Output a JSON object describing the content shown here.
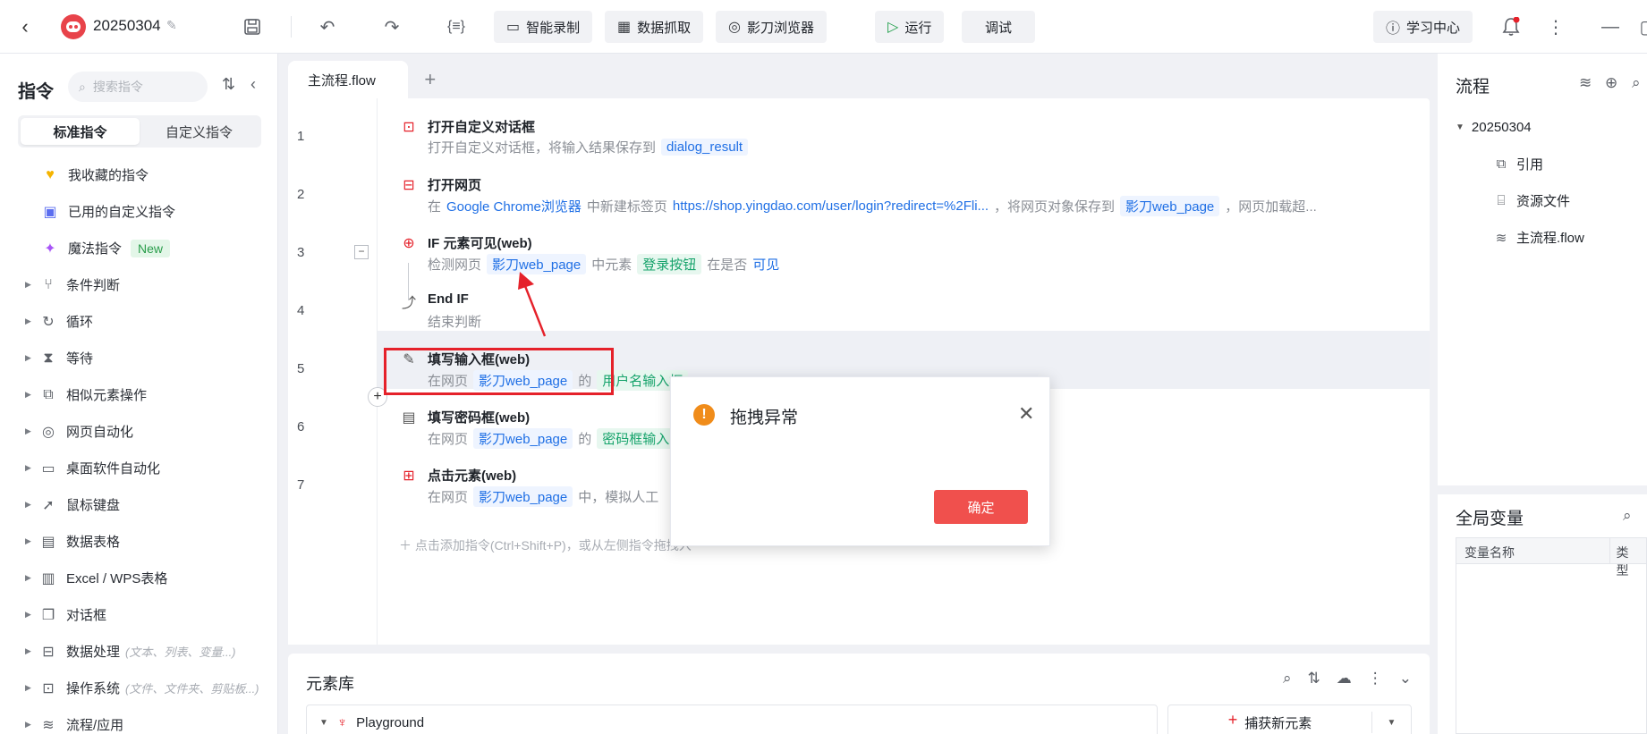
{
  "header": {
    "project_name": "20250304",
    "buttons": {
      "smart_record": "智能录制",
      "data_capture": "数据抓取",
      "browser": "影刀浏览器",
      "run": "运行",
      "debug": "调试",
      "learning": "学习中心"
    }
  },
  "sidebar": {
    "title": "指令",
    "search_placeholder": "搜索指令",
    "tabs": [
      "标准指令",
      "自定义指令"
    ],
    "special_items": [
      {
        "label": "我收藏的指令",
        "icon": "heart-icon"
      },
      {
        "label": "已用的自定义指令",
        "icon": "calendar-icon"
      },
      {
        "label": "魔法指令",
        "icon": "sparkle-icon",
        "badge": "New"
      }
    ],
    "categories": [
      {
        "label": "条件判断",
        "icon": "branch-icon",
        "note": ""
      },
      {
        "label": "循环",
        "icon": "loop-icon",
        "note": ""
      },
      {
        "label": "等待",
        "icon": "hourglass-icon",
        "note": ""
      },
      {
        "label": "相似元素操作",
        "icon": "copy-icon",
        "note": ""
      },
      {
        "label": "网页自动化",
        "icon": "browser-icon",
        "note": ""
      },
      {
        "label": "桌面软件自动化",
        "icon": "monitor-icon",
        "note": ""
      },
      {
        "label": "鼠标键盘",
        "icon": "cursor-icon",
        "note": ""
      },
      {
        "label": "数据表格",
        "icon": "document-icon",
        "note": ""
      },
      {
        "label": "Excel / WPS表格",
        "icon": "excel-icon",
        "note": ""
      },
      {
        "label": "对话框",
        "icon": "dialog-icon",
        "note": ""
      },
      {
        "label": "数据处理",
        "icon": "data-icon",
        "note": "(文本、列表、变量...)"
      },
      {
        "label": "操作系统",
        "icon": "briefcase-icon",
        "note": "(文件、文件夹、剪贴板...)"
      },
      {
        "label": "流程/应用",
        "icon": "layers-icon",
        "note": ""
      }
    ]
  },
  "editor": {
    "tab_name": "主流程.flow",
    "rows": [
      {
        "num": "1",
        "title": "打开自定义对话框",
        "desc": [
          {
            "t": "text",
            "v": "打开自定义对话框，将输入结果保存到"
          },
          {
            "t": "tag",
            "v": "dialog_result"
          }
        ]
      },
      {
        "num": "2",
        "title": "打开网页",
        "desc": [
          {
            "t": "text",
            "v": "在"
          },
          {
            "t": "link",
            "v": "Google Chrome浏览器"
          },
          {
            "t": "text",
            "v": "中新建标签页"
          },
          {
            "t": "link",
            "v": "https://shop.yingdao.com/user/login?redirect=%2Fli..."
          },
          {
            "t": "text",
            "v": "，将网页对象保存到"
          },
          {
            "t": "tag",
            "v": "影刀web_page"
          },
          {
            "t": "text",
            "v": "，网页加载超..."
          }
        ]
      },
      {
        "num": "3",
        "title": "IF 元素可见(web)",
        "desc": [
          {
            "t": "text",
            "v": "检测网页"
          },
          {
            "t": "tag",
            "v": "影刀web_page"
          },
          {
            "t": "text",
            "v": "中元素"
          },
          {
            "t": "tag-g",
            "v": "登录按钮"
          },
          {
            "t": "text",
            "v": "在是否"
          },
          {
            "t": "link",
            "v": "可见"
          }
        ]
      },
      {
        "num": "4",
        "title": "End IF",
        "desc": [
          {
            "t": "text",
            "v": "结束判断"
          }
        ]
      },
      {
        "num": "5",
        "title": "填写输入框(web)",
        "desc": [
          {
            "t": "text",
            "v": "在网页"
          },
          {
            "t": "tag",
            "v": "影刀web_page"
          },
          {
            "t": "text",
            "v": "的"
          },
          {
            "t": "tag-g",
            "v": "用户名输入框"
          }
        ]
      },
      {
        "num": "6",
        "title": "填写密码框(web)",
        "desc": [
          {
            "t": "text",
            "v": "在网页"
          },
          {
            "t": "tag",
            "v": "影刀web_page"
          },
          {
            "t": "text",
            "v": "的"
          },
          {
            "t": "tag-g",
            "v": "密码框输入"
          }
        ]
      },
      {
        "num": "7",
        "title": "点击元素(web)",
        "desc": [
          {
            "t": "text",
            "v": "在网页"
          },
          {
            "t": "tag",
            "v": "影刀web_page"
          },
          {
            "t": "text",
            "v": "中，模拟人工"
          }
        ]
      }
    ],
    "add_hint": "点击添加指令(Ctrl+Shift+P)，或从左侧指令拖拽入"
  },
  "element_library": {
    "title": "元素库",
    "tree_root": "Playground",
    "capture_label": "捕获新元素"
  },
  "right_panel": {
    "title": "流程",
    "root": "20250304",
    "nodes": [
      {
        "label": "引用",
        "icon": "reference-icon"
      },
      {
        "label": "资源文件",
        "icon": "file-icon"
      },
      {
        "label": "主流程.flow",
        "icon": "layers-icon"
      }
    ],
    "globals_title": "全局变量",
    "columns": [
      "变量名称",
      "类型"
    ]
  },
  "dialog": {
    "title": "拖拽异常",
    "ok_label": "确定"
  },
  "colors": {
    "accent_red": "#f0504d",
    "highlight_box": "#e5212a",
    "tag_blue": "#1f6fe5",
    "tag_green": "#16a36b",
    "warning_orange": "#f08c1a",
    "run_green": "#22a04b"
  }
}
